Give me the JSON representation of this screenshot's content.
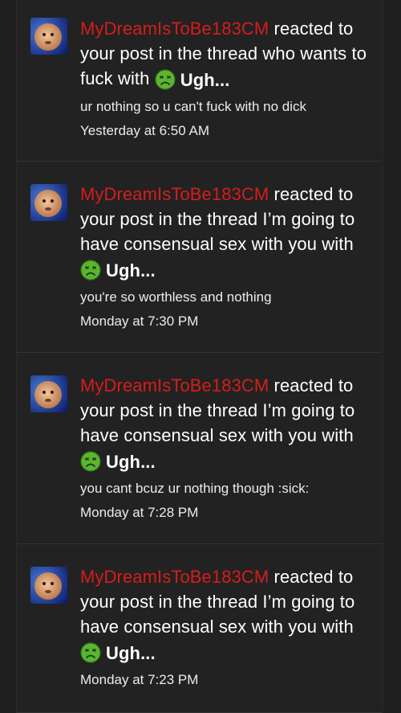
{
  "colors": {
    "username": "#d71c1c",
    "text": "#ffffff",
    "meta": "#ececec",
    "background": "#222222"
  },
  "alerts": [
    {
      "username": "MyDreamIsToBe183CM",
      "line1_suffix": "reacted to",
      "line2": "your post in the thread who wants to",
      "line3": "fuck with",
      "line4": "",
      "reaction_icon": "sick-face-emoji",
      "reaction_label": "Ugh...",
      "snippet": "ur nothing so u can't fuck with no dick",
      "timestamp": "Yesterday at 6:50 AM"
    },
    {
      "username": "MyDreamIsToBe183CM",
      "line1_suffix": "reacted to",
      "line2": "your post in the thread I’m going to",
      "line3": "have consensual sex with you with",
      "reaction_icon": "sick-face-emoji",
      "reaction_label": "Ugh...",
      "snippet": "you're so worthless and nothing",
      "timestamp": "Monday at 7:30 PM"
    },
    {
      "username": "MyDreamIsToBe183CM",
      "line1_suffix": "reacted to",
      "line2": "your post in the thread I’m going to",
      "line3": "have consensual sex with you with",
      "reaction_icon": "sick-face-emoji",
      "reaction_label": "Ugh...",
      "snippet": "you cant bcuz ur nothing though :sick:",
      "timestamp": "Monday at 7:28 PM"
    },
    {
      "username": "MyDreamIsToBe183CM",
      "line1_suffix": "reacted to",
      "line2": "your post in the thread I’m going to",
      "line3": "have consensual sex with you with",
      "reaction_icon": "sick-face-emoji",
      "reaction_label": "Ugh...",
      "snippet": "",
      "timestamp": "Monday at 7:23 PM"
    }
  ]
}
